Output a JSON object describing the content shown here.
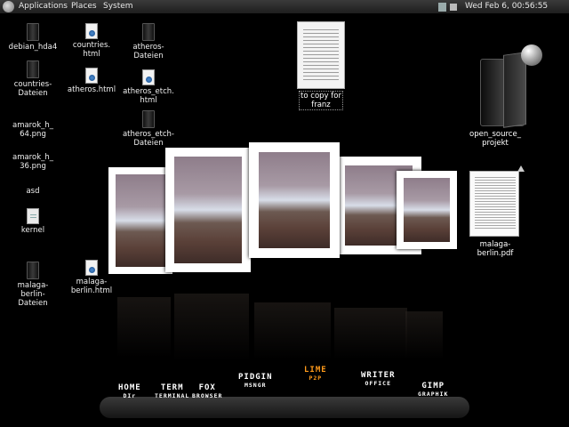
{
  "panel": {
    "menus": [
      "Applications",
      "Places",
      "System"
    ],
    "clock": "Wed Feb  6, 00:56:55"
  },
  "desktop_icons": [
    {
      "label": "debian_hda4",
      "kind": "folder"
    },
    {
      "label": "countries.\nhtml",
      "kind": "web"
    },
    {
      "label": "atheros-\nDateien",
      "kind": "folder"
    },
    {
      "label": "countries-\nDateien",
      "kind": "folder"
    },
    {
      "label": "atheros.html",
      "kind": "web"
    },
    {
      "label": "atheros_etch.\nhtml",
      "kind": "web"
    },
    {
      "label": "atheros_etch-\nDateien",
      "kind": "folder"
    },
    {
      "label": "amarok_h_\n64.png",
      "kind": "image"
    },
    {
      "label": "amarok_h_\n36.png",
      "kind": "image"
    },
    {
      "label": "asd",
      "kind": "text"
    },
    {
      "label": "kernel",
      "kind": "doc"
    },
    {
      "label": "malaga-\nberlin-\nDateien",
      "kind": "folder"
    },
    {
      "label": "malaga-\nberlin.html",
      "kind": "web"
    }
  ],
  "big_doc": {
    "label": "to copy for\nfranz"
  },
  "big_folder": {
    "label": "open_source_\nprojekt"
  },
  "pdf": {
    "label": "malaga-\nberlin.pdf"
  },
  "dock": [
    {
      "big": "HOME",
      "small": "DIr",
      "color": "#ffffff"
    },
    {
      "big": "TERM",
      "small": "TERMINAL",
      "color": "#ffffff"
    },
    {
      "big": "FOX",
      "small": "BROWSER",
      "color": "#ffffff"
    },
    {
      "big": "PIDGIN",
      "small": "MSNGR",
      "color": "#ffffff"
    },
    {
      "big": "LIME",
      "small": "P2P",
      "color": "#ff9a1a"
    },
    {
      "big": "WRITER",
      "small": "OFFICE",
      "color": "#ffffff"
    },
    {
      "big": "GIMP",
      "small": "GRAPHIK",
      "color": "#ffffff"
    }
  ]
}
